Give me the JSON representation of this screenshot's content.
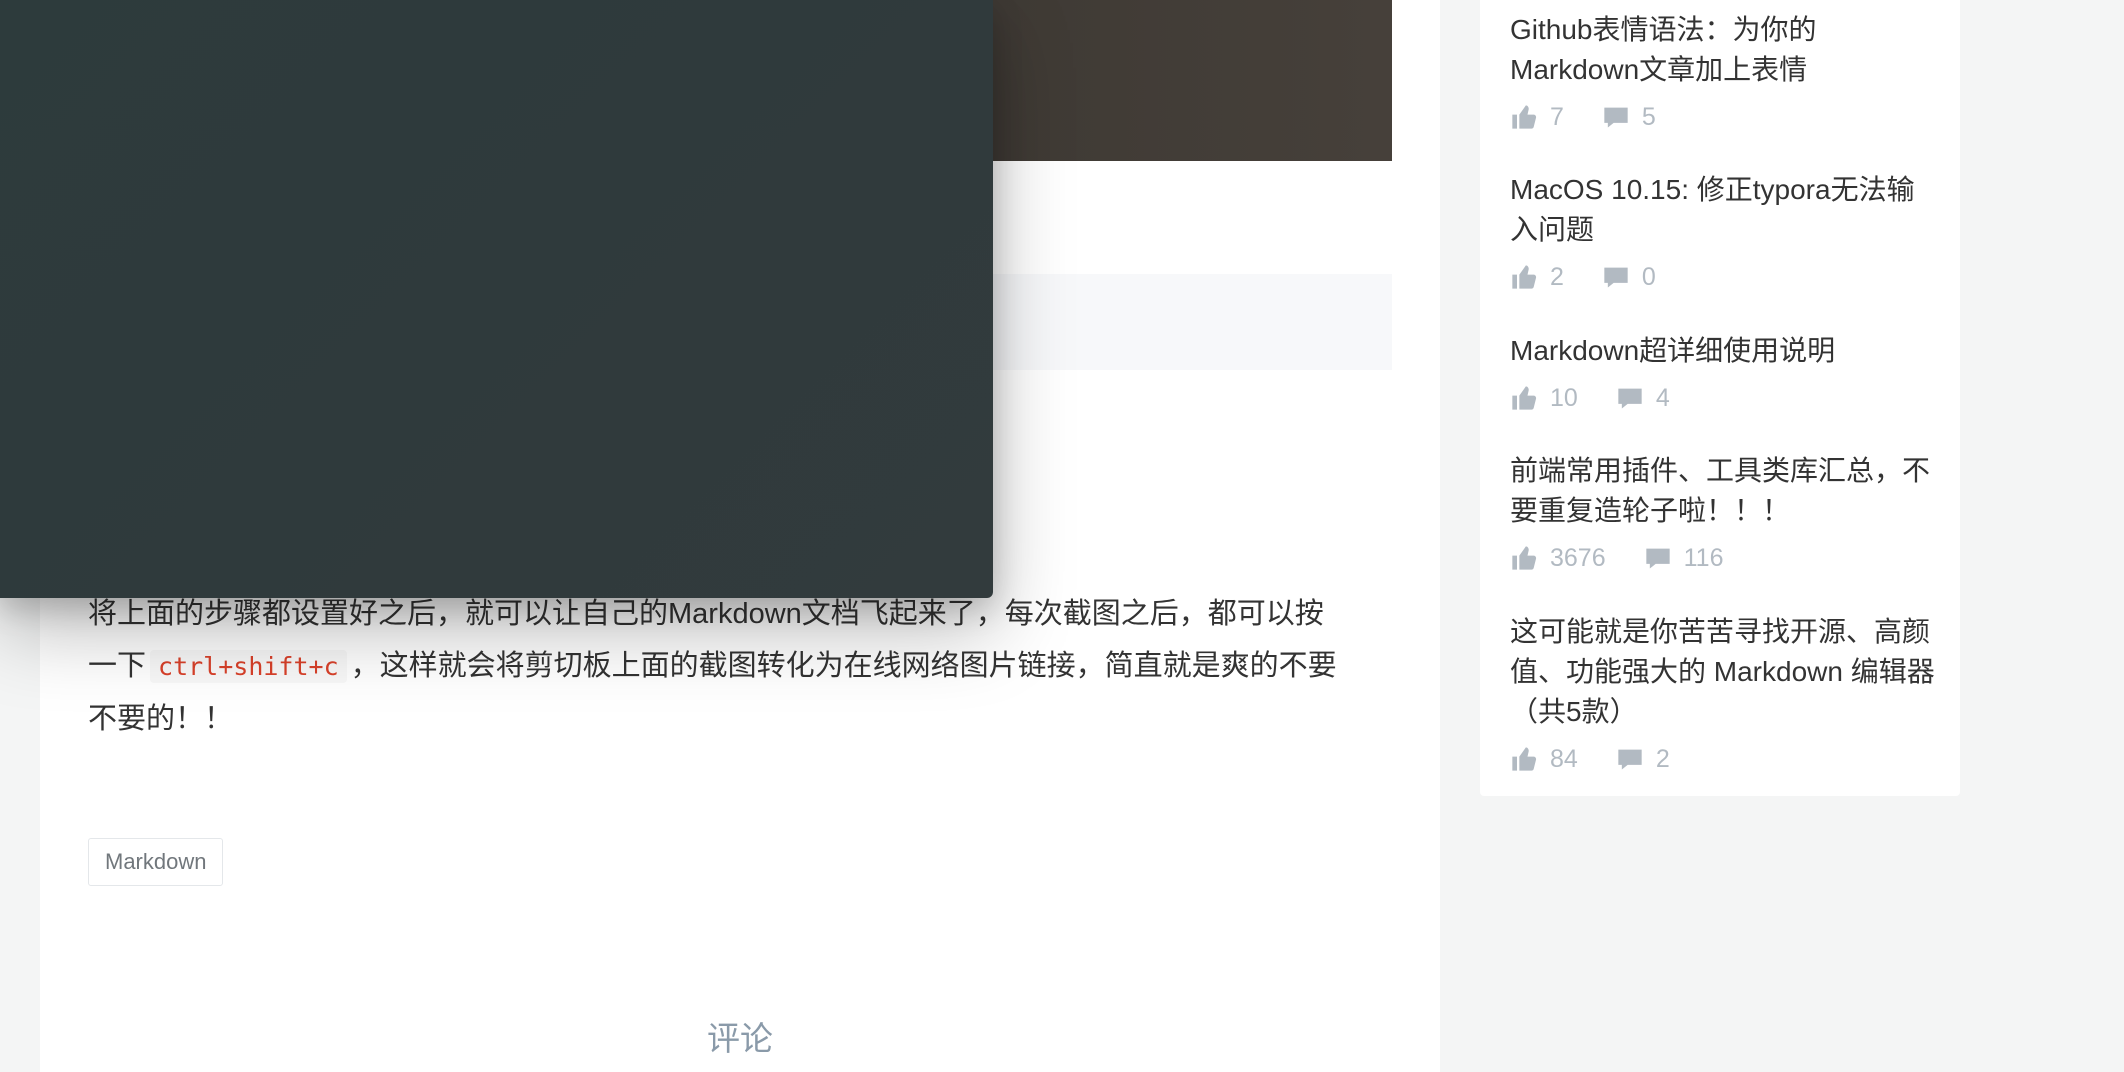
{
  "article": {
    "paragraph_lines": [
      "将上面的步骤都设置好之后，就可以让自己的Markdown文档飞起来了，每次截图之后，都可以按",
      "一下",
      "，这样就会将剪切板上面的截图转化为在线网络图片链接，简直就是爽的不要",
      "不要的！！"
    ],
    "code": "ctrl+shift+c",
    "tag": "Markdown",
    "comment_heading": "评论"
  },
  "sidebar": {
    "entries": [
      {
        "title": "Github表情语法：为你的Markdown文章加上表情",
        "likes": "7",
        "comments": "5"
      },
      {
        "title": "MacOS 10.15: 修正typora无法输入问题",
        "likes": "2",
        "comments": "0"
      },
      {
        "title": "Markdown超详细使用说明",
        "likes": "10",
        "comments": "4"
      },
      {
        "title": "前端常用插件、工具类库汇总，不要重复造轮子啦！！！",
        "likes": "3676",
        "comments": "116"
      },
      {
        "title": "这可能就是你苦苦寻找开源、高颜值、功能强大的 Markdown 编辑器（共5款）",
        "likes": "84",
        "comments": "2"
      }
    ]
  },
  "colors": {
    "page_bg": "#f4f5f5",
    "overlay": "#2f3a3c",
    "code": "#d9412a",
    "meta": "#b2bac2"
  }
}
